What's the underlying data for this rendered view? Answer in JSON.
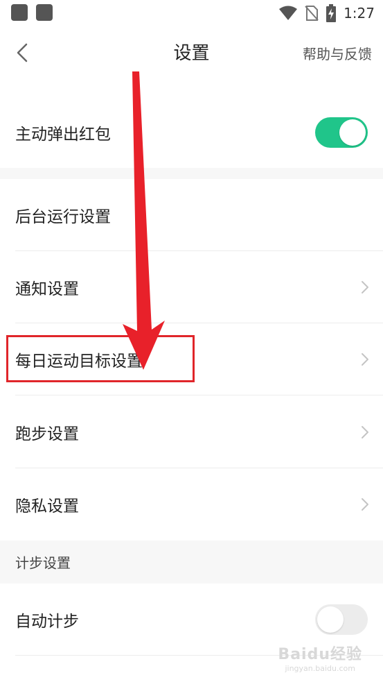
{
  "status_bar": {
    "time": "1:27",
    "icons": [
      "app-icon",
      "app-icon",
      "wifi-icon",
      "no-sim-icon",
      "battery-charging-icon"
    ]
  },
  "header": {
    "title": "设置",
    "back_icon": "chevron-left-icon",
    "help_label": "帮助与反馈"
  },
  "rows": {
    "auto_popup": {
      "label": "主动弹出红包",
      "toggle_on": true
    },
    "background_run": {
      "label": "后台运行设置"
    },
    "notification": {
      "label": "通知设置"
    },
    "daily_goal": {
      "label": "每日运动目标设置"
    },
    "running": {
      "label": "跑步设置"
    },
    "privacy": {
      "label": "隐私设置"
    },
    "auto_step": {
      "label": "自动计步",
      "toggle_on": false
    }
  },
  "sections": {
    "step_settings": "计步设置"
  },
  "colors": {
    "toggle_on": "#20c58a",
    "toggle_off": "#ececec",
    "annotation_red": "#e0252a",
    "section_bg": "#f7f7f7"
  },
  "watermark": {
    "main": "Baidu经验",
    "sub": "jingyan.baidu.com"
  }
}
